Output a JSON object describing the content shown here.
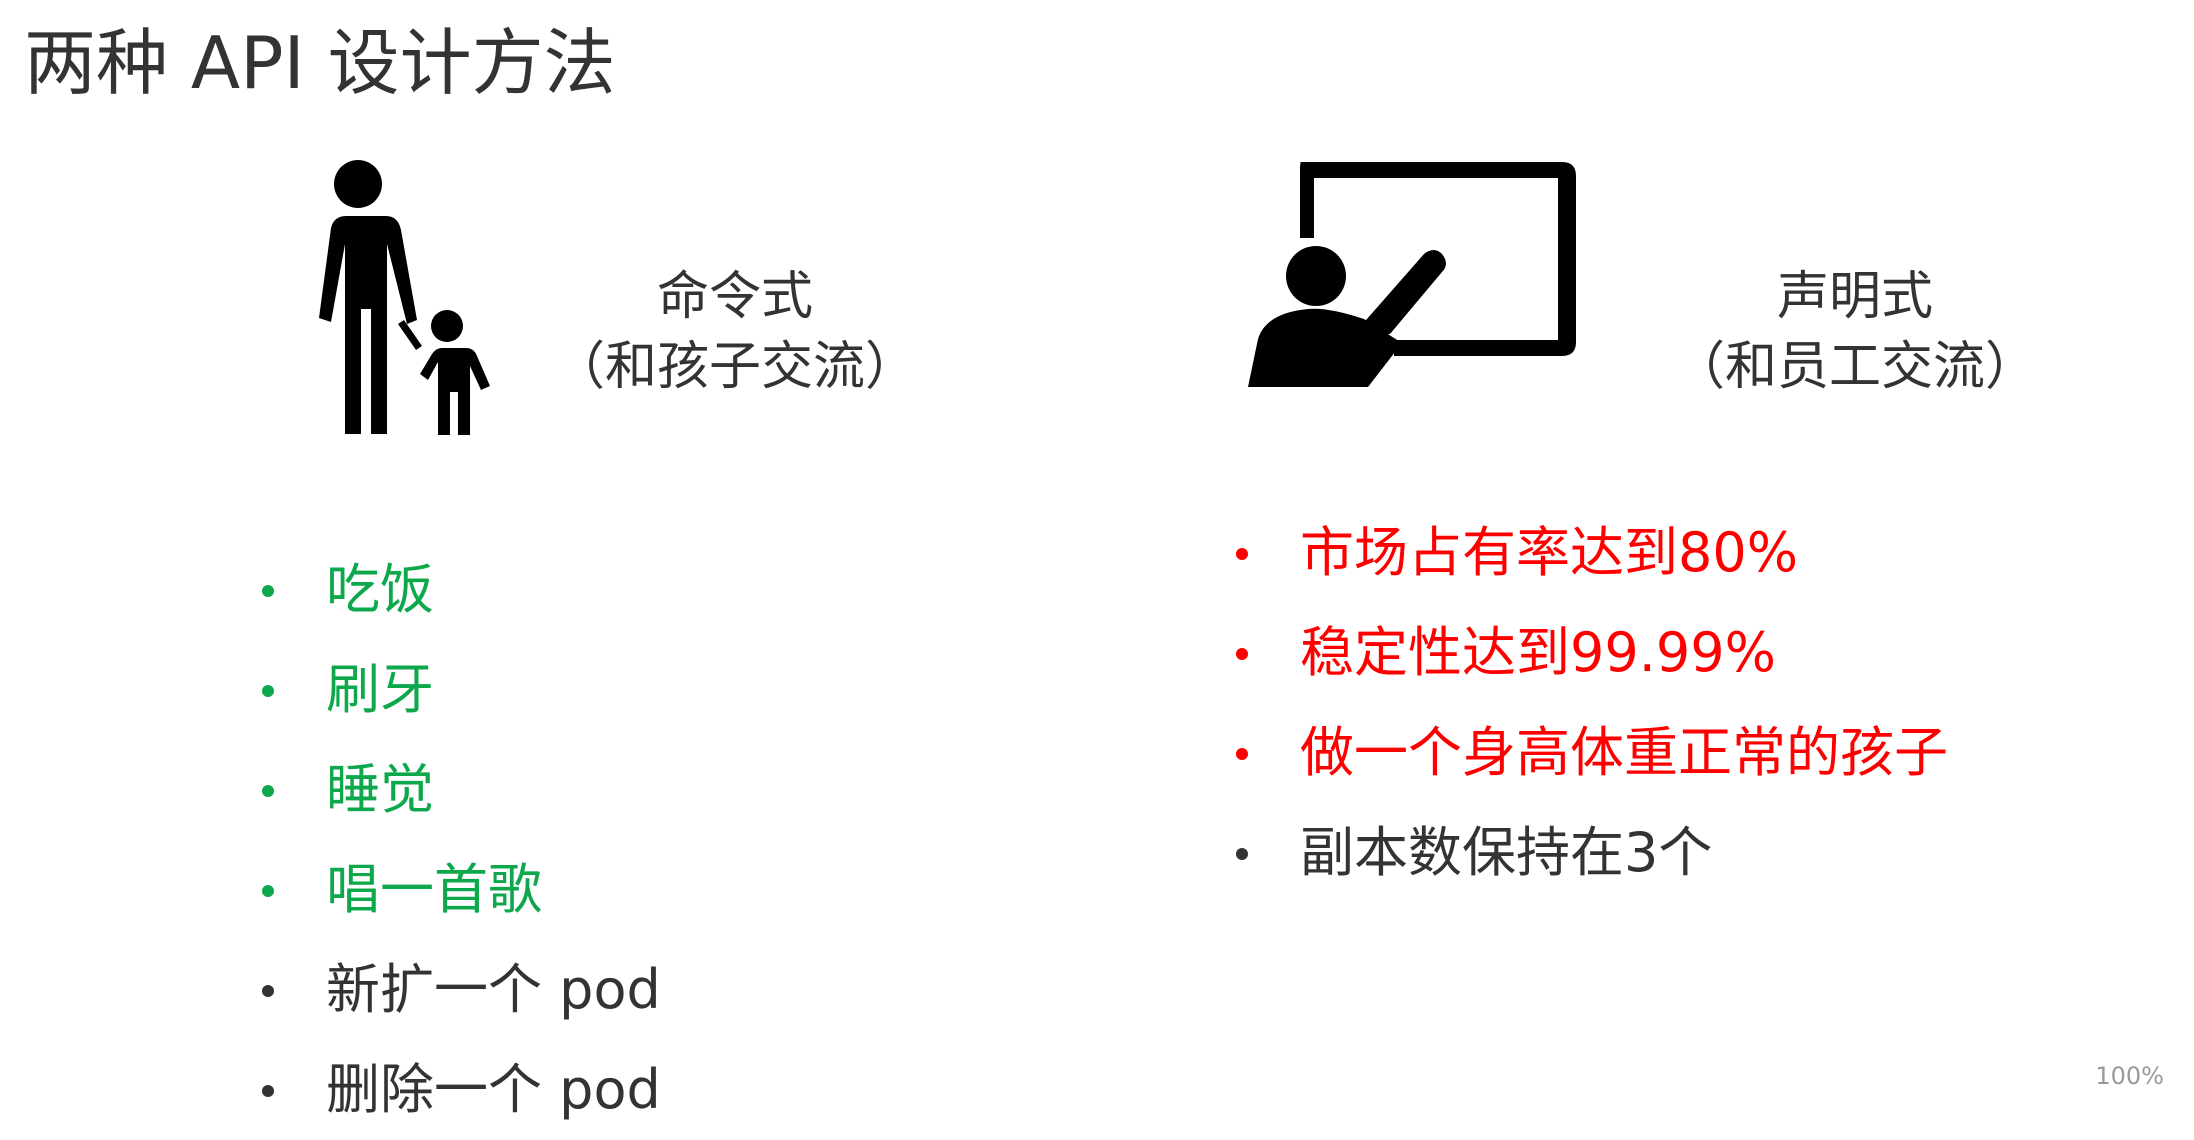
{
  "slide": {
    "title": "两种 API 设计方法",
    "zoom": "100%"
  },
  "left": {
    "icon": "parent-child-icon",
    "caption_line1": "命令式",
    "caption_line2": "（和孩子交流）",
    "items": [
      {
        "text": "吃饭",
        "color": "#0ea84c"
      },
      {
        "text": "刷牙",
        "color": "#0ea84c"
      },
      {
        "text": "睡觉",
        "color": "#0ea84c"
      },
      {
        "text": "唱一首歌",
        "color": "#0ea84c"
      },
      {
        "text": "新扩一个 pod",
        "color": "#333333"
      },
      {
        "text": "删除一个 pod",
        "color": "#333333"
      }
    ]
  },
  "right": {
    "icon": "presenter-board-icon",
    "caption_line1": "声明式",
    "caption_line2": "（和员工交流）",
    "items": [
      {
        "text": "市场占有率达到80%",
        "color": "#ff0000"
      },
      {
        "text": "稳定性达到99.99%",
        "color": "#ff0000"
      },
      {
        "text": "做一个身高体重正常的孩子",
        "color": "#ff0000"
      },
      {
        "text": "副本数保持在3个",
        "color": "#333333"
      }
    ]
  }
}
